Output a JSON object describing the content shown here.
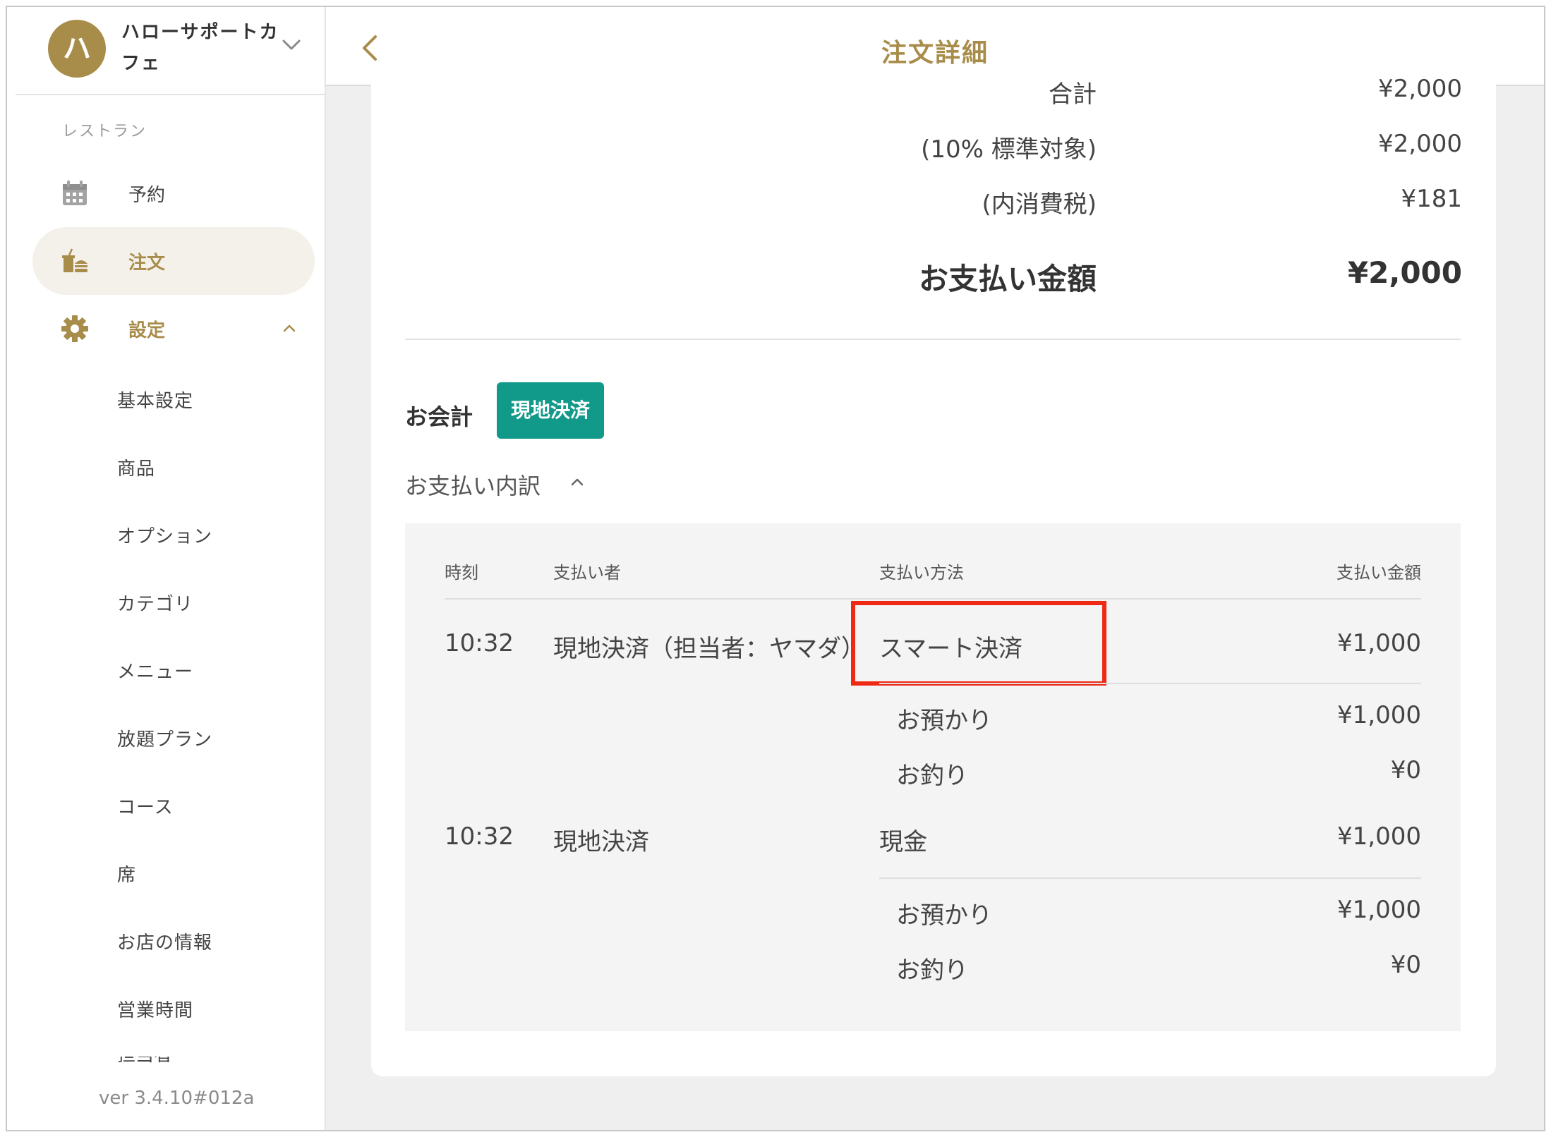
{
  "store": {
    "avatar_initial": "ハ",
    "name": "ハローサポートカフェ"
  },
  "sidebar": {
    "section_label": "レストラン",
    "items": [
      {
        "label": "予約",
        "icon": "calendar-icon"
      },
      {
        "label": "注文",
        "icon": "food-tray-icon",
        "active": true
      },
      {
        "label": "設定",
        "icon": "gear-icon",
        "expanded": true
      }
    ],
    "sub_items": [
      "基本設定",
      "商品",
      "オプション",
      "カテゴリ",
      "メニュー",
      "放題プラン",
      "コース",
      "席",
      "お店の情報",
      "営業時間",
      "担当者"
    ],
    "version": "ver 3.4.10#012a"
  },
  "header": {
    "title": "注文詳細"
  },
  "summary": {
    "rows": [
      {
        "label": "合計",
        "value": "¥2,000"
      },
      {
        "label": "(10% 標準対象)",
        "value": "¥2,000"
      },
      {
        "label": "(内消費税)",
        "value": "¥181"
      }
    ],
    "total_label": "お支払い金額",
    "total_value": "¥2,000"
  },
  "accounting": {
    "title": "お会計",
    "badge": "現地決済",
    "breakdown_label": "お支払い内訳"
  },
  "payments": {
    "headers": {
      "time": "時刻",
      "payer": "支払い者",
      "method": "支払い方法",
      "amount": "支払い金額"
    },
    "rows": [
      {
        "time": "10:32",
        "payer": "現地決済（担当者：ヤマダ）",
        "method": "スマート決済",
        "amount": "¥1,000",
        "deposit_label": "お預かり",
        "deposit_value": "¥1,000",
        "change_label": "お釣り",
        "change_value": "¥0"
      },
      {
        "time": "10:32",
        "payer": "現地決済",
        "method": "現金",
        "amount": "¥1,000",
        "deposit_label": "お預かり",
        "deposit_value": "¥1,000",
        "change_label": "お釣り",
        "change_value": "¥0"
      }
    ]
  },
  "colors": {
    "brand_gold": "#a88c4a",
    "badge_green": "#11998a",
    "highlight_red": "#ee2a14"
  }
}
